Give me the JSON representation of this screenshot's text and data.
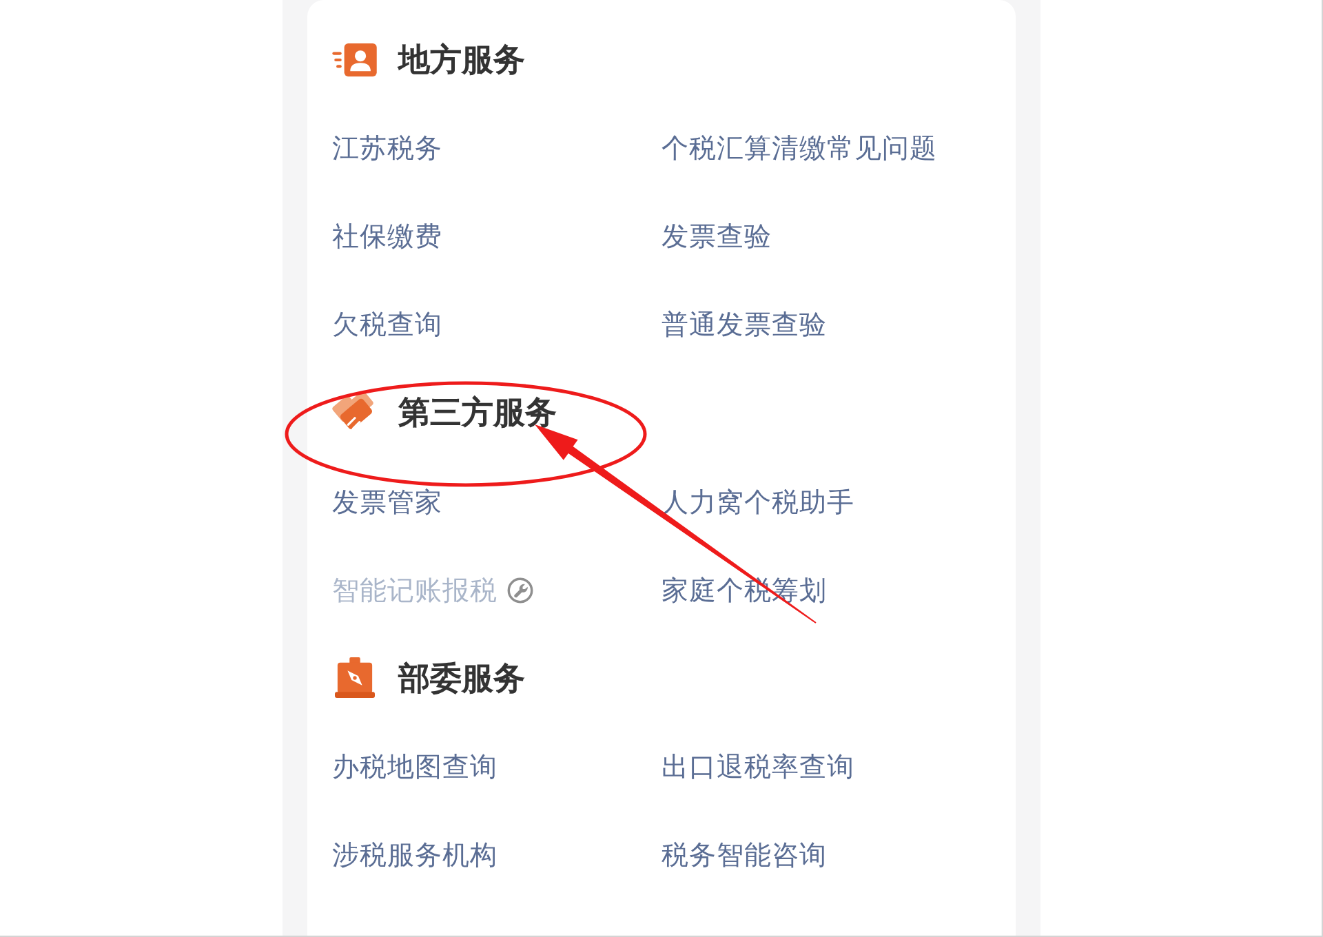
{
  "sections": [
    {
      "title": "地方服务",
      "kind": "person-card",
      "circled": false,
      "items": [
        {
          "label": "江苏税务",
          "disabled": false
        },
        {
          "label": "个税汇算清缴常见问题",
          "disabled": false
        },
        {
          "label": "社保缴费",
          "disabled": false
        },
        {
          "label": "发票查验",
          "disabled": false
        },
        {
          "label": "欠税查询",
          "disabled": false
        },
        {
          "label": "普通发票查验",
          "disabled": false
        }
      ]
    },
    {
      "title": "第三方服务",
      "kind": "handshake",
      "circled": true,
      "items": [
        {
          "label": "发票管家",
          "disabled": false
        },
        {
          "label": "人力窝个税助手",
          "disabled": false
        },
        {
          "label": "智能记账报税",
          "disabled": true
        },
        {
          "label": "家庭个税筹划",
          "disabled": false
        }
      ]
    },
    {
      "title": "部委服务",
      "kind": "compass",
      "circled": false,
      "items": [
        {
          "label": "办税地图查询",
          "disabled": false
        },
        {
          "label": "出口退税率查询",
          "disabled": false
        },
        {
          "label": "涉税服务机构",
          "disabled": false
        },
        {
          "label": "税务智能咨询",
          "disabled": false
        }
      ]
    }
  ]
}
